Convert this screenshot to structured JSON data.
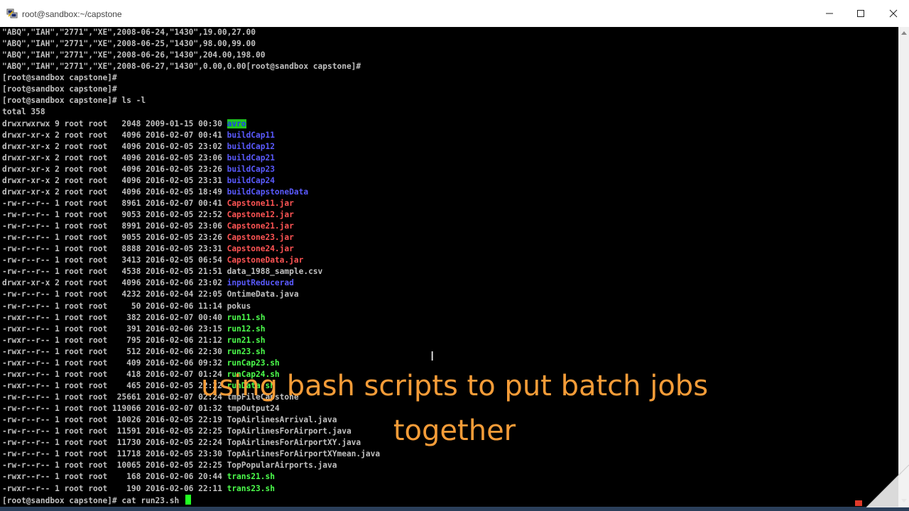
{
  "window": {
    "title": "root@sandbox:~/capstone",
    "icon": "putty-icon",
    "minimize_icon": "minimize-icon",
    "maximize_icon": "maximize-icon",
    "close_icon": "close-icon"
  },
  "terminal": {
    "lines": [
      {
        "segments": [
          {
            "text": "\"ABQ\",\"IAH\",\"2771\",\"XE\",2008-06-24,\"1430\",19.00,27.00",
            "color": "white"
          }
        ]
      },
      {
        "segments": [
          {
            "text": "\"ABQ\",\"IAH\",\"2771\",\"XE\",2008-06-25,\"1430\",98.00,99.00",
            "color": "white"
          }
        ]
      },
      {
        "segments": [
          {
            "text": "\"ABQ\",\"IAH\",\"2771\",\"XE\",2008-06-26,\"1430\",204.00,198.00",
            "color": "white"
          }
        ]
      },
      {
        "segments": [
          {
            "text": "\"ABQ\",\"IAH\",\"2771\",\"XE\",2008-06-27,\"1430\",0.00,0.00[root@sandbox capstone]#",
            "color": "white"
          }
        ]
      },
      {
        "segments": [
          {
            "text": "[root@sandbox capstone]#",
            "color": "white"
          }
        ]
      },
      {
        "segments": [
          {
            "text": "[root@sandbox capstone]#",
            "color": "white"
          }
        ]
      },
      {
        "segments": [
          {
            "text": "[root@sandbox capstone]# ls -l",
            "color": "white"
          }
        ]
      },
      {
        "segments": [
          {
            "text": "total 358",
            "color": "white"
          }
        ]
      },
      {
        "segments": [
          {
            "text": "drwxrwxrwx 9 root root   2048 2009-01-15 00:30 ",
            "color": "white"
          },
          {
            "text": "avro",
            "color": "hl"
          }
        ]
      },
      {
        "segments": [
          {
            "text": "drwxr-xr-x 2 root root   4096 2016-02-07 00:41 ",
            "color": "white"
          },
          {
            "text": "buildCap11",
            "color": "blue"
          }
        ]
      },
      {
        "segments": [
          {
            "text": "drwxr-xr-x 2 root root   4096 2016-02-05 23:02 ",
            "color": "white"
          },
          {
            "text": "buildCap12",
            "color": "blue"
          }
        ]
      },
      {
        "segments": [
          {
            "text": "drwxr-xr-x 2 root root   4096 2016-02-05 23:06 ",
            "color": "white"
          },
          {
            "text": "buildCap21",
            "color": "blue"
          }
        ]
      },
      {
        "segments": [
          {
            "text": "drwxr-xr-x 2 root root   4096 2016-02-05 23:26 ",
            "color": "white"
          },
          {
            "text": "buildCap23",
            "color": "blue"
          }
        ]
      },
      {
        "segments": [
          {
            "text": "drwxr-xr-x 2 root root   4096 2016-02-05 23:31 ",
            "color": "white"
          },
          {
            "text": "buildCap24",
            "color": "blue"
          }
        ]
      },
      {
        "segments": [
          {
            "text": "drwxr-xr-x 2 root root   4096 2016-02-05 18:49 ",
            "color": "white"
          },
          {
            "text": "buildCapstoneData",
            "color": "blue"
          }
        ]
      },
      {
        "segments": [
          {
            "text": "-rw-r--r-- 1 root root   8961 2016-02-07 00:41 ",
            "color": "white"
          },
          {
            "text": "Capstone11.jar",
            "color": "red"
          }
        ]
      },
      {
        "segments": [
          {
            "text": "-rw-r--r-- 1 root root   9053 2016-02-05 22:52 ",
            "color": "white"
          },
          {
            "text": "Capstone12.jar",
            "color": "red"
          }
        ]
      },
      {
        "segments": [
          {
            "text": "-rw-r--r-- 1 root root   8991 2016-02-05 23:06 ",
            "color": "white"
          },
          {
            "text": "Capstone21.jar",
            "color": "red"
          }
        ]
      },
      {
        "segments": [
          {
            "text": "-rw-r--r-- 1 root root   9055 2016-02-05 23:26 ",
            "color": "white"
          },
          {
            "text": "Capstone23.jar",
            "color": "red"
          }
        ]
      },
      {
        "segments": [
          {
            "text": "-rw-r--r-- 1 root root   8888 2016-02-05 23:31 ",
            "color": "white"
          },
          {
            "text": "Capstone24.jar",
            "color": "red"
          }
        ]
      },
      {
        "segments": [
          {
            "text": "-rw-r--r-- 1 root root   3413 2016-02-05 06:54 ",
            "color": "white"
          },
          {
            "text": "CapstoneData.jar",
            "color": "red"
          }
        ]
      },
      {
        "segments": [
          {
            "text": "-rw-r--r-- 1 root root   4538 2016-02-05 21:51 data_1988_sample.csv",
            "color": "white"
          }
        ]
      },
      {
        "segments": [
          {
            "text": "drwxr-xr-x 2 root root   4096 2016-02-06 23:02 ",
            "color": "white"
          },
          {
            "text": "inputReducerad",
            "color": "blue"
          }
        ]
      },
      {
        "segments": [
          {
            "text": "-rw-r--r-- 1 root root   4232 2016-02-04 22:05 OntimeData.java",
            "color": "white"
          }
        ]
      },
      {
        "segments": [
          {
            "text": "-rw-r--r-- 1 root root     50 2016-02-06 11:14 pokus",
            "color": "white"
          }
        ]
      },
      {
        "segments": [
          {
            "text": "-rwxr--r-- 1 root root    382 2016-02-07 00:40 ",
            "color": "white"
          },
          {
            "text": "run11.sh",
            "color": "green"
          }
        ]
      },
      {
        "segments": [
          {
            "text": "-rwxr--r-- 1 root root    391 2016-02-06 23:15 ",
            "color": "white"
          },
          {
            "text": "run12.sh",
            "color": "green"
          }
        ]
      },
      {
        "segments": [
          {
            "text": "-rwxr--r-- 1 root root    795 2016-02-06 21:12 ",
            "color": "white"
          },
          {
            "text": "run21.sh",
            "color": "green"
          }
        ]
      },
      {
        "segments": [
          {
            "text": "-rwxr--r-- 1 root root    512 2016-02-06 22:30 ",
            "color": "white"
          },
          {
            "text": "run23.sh",
            "color": "green"
          }
        ]
      },
      {
        "segments": [
          {
            "text": "-rwxr--r-- 1 root root    409 2016-02-06 09:32 ",
            "color": "white"
          },
          {
            "text": "runCap23.sh",
            "color": "green"
          }
        ]
      },
      {
        "segments": [
          {
            "text": "-rwxr--r-- 1 root root    418 2016-02-07 01:24 ",
            "color": "white"
          },
          {
            "text": "runCap24.sh",
            "color": "green"
          }
        ]
      },
      {
        "segments": [
          {
            "text": "-rwxr--r-- 1 root root    465 2016-02-05 22:22 ",
            "color": "white"
          },
          {
            "text": "runData.sh",
            "color": "green"
          }
        ]
      },
      {
        "segments": [
          {
            "text": "-rw-r--r-- 1 root root  25661 2016-02-07 02:24 tmpFileCapstone",
            "color": "white"
          }
        ]
      },
      {
        "segments": [
          {
            "text": "-rw-r--r-- 1 root root 119066 2016-02-07 01:32 tmpOutput24",
            "color": "white"
          }
        ]
      },
      {
        "segments": [
          {
            "text": "-rw-r--r-- 1 root root  10026 2016-02-05 22:19 TopAirlinesArrival.java",
            "color": "white"
          }
        ]
      },
      {
        "segments": [
          {
            "text": "-rw-r--r-- 1 root root  11591 2016-02-05 22:25 TopAirlinesForAirport.java",
            "color": "white"
          }
        ]
      },
      {
        "segments": [
          {
            "text": "-rw-r--r-- 1 root root  11730 2016-02-05 22:24 TopAirlinesForAirportXY.java",
            "color": "white"
          }
        ]
      },
      {
        "segments": [
          {
            "text": "-rw-r--r-- 1 root root  11718 2016-02-05 23:30 TopAirlinesForAirportXYmean.java",
            "color": "white"
          }
        ]
      },
      {
        "segments": [
          {
            "text": "-rw-r--r-- 1 root root  10065 2016-02-05 22:25 TopPopularAirports.java",
            "color": "white"
          }
        ]
      },
      {
        "segments": [
          {
            "text": "-rwxr--r-- 1 root root    168 2016-02-06 20:44 ",
            "color": "white"
          },
          {
            "text": "trans21.sh",
            "color": "green"
          }
        ]
      },
      {
        "segments": [
          {
            "text": "-rwxr--r-- 1 root root    190 2016-02-06 22:11 ",
            "color": "white"
          },
          {
            "text": "trans23.sh",
            "color": "green"
          }
        ]
      },
      {
        "segments": [
          {
            "text": "[root@sandbox capstone]# cat run23.sh ",
            "color": "white"
          }
        ],
        "cursor": true
      }
    ]
  },
  "caption": {
    "line1": "using bash scripts to put batch jobs",
    "line2": "together"
  },
  "colors": {
    "terminal_bg": "#000000",
    "text": "#c0c0c0",
    "directory": "#5a5aff",
    "archive": "#ff5454",
    "executable": "#4cff4c",
    "caption": "#f59c38"
  }
}
